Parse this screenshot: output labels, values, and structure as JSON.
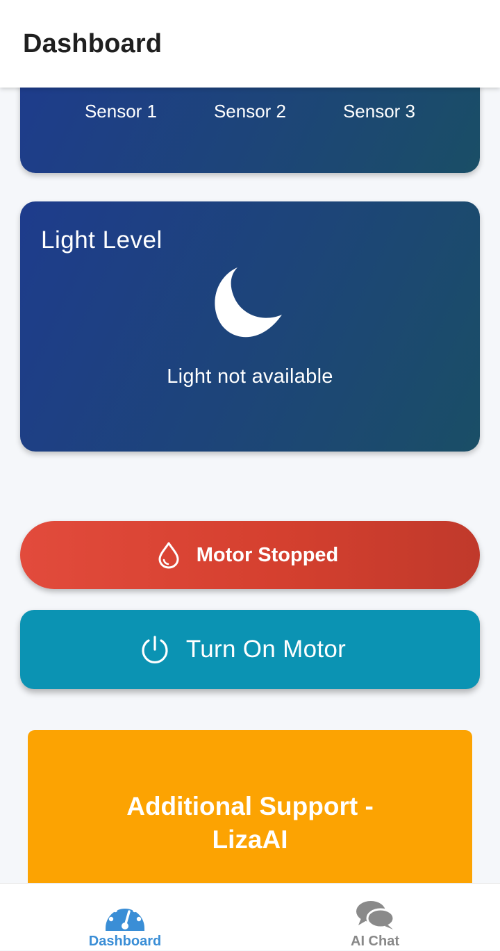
{
  "header": {
    "title": "Dashboard"
  },
  "sensors": {
    "labels": [
      "Sensor 1",
      "Sensor 2",
      "Sensor 3"
    ]
  },
  "light_card": {
    "title": "Light Level",
    "icon": "moon-icon",
    "status": "Light not available"
  },
  "motor": {
    "status_label": "Motor Stopped",
    "status_icon": "water-drop-icon",
    "status_color": "#e24b3c",
    "button_label": "Turn On Motor",
    "button_icon": "power-icon",
    "button_color": "#0b93b3"
  },
  "support": {
    "label": "Additional Support - LizaAI",
    "color": "#fca302"
  },
  "bottom_nav": {
    "items": [
      {
        "label": "Dashboard",
        "icon": "speedometer-icon",
        "active": true,
        "color": "#3a8ed6"
      },
      {
        "label": "AI Chat",
        "icon": "chat-bubbles-icon",
        "active": false,
        "color": "#888888"
      }
    ]
  },
  "colors": {
    "card_gradient_start": "#1e3c8c",
    "card_gradient_end": "#1a4e66",
    "background": "#f5f7fa"
  }
}
